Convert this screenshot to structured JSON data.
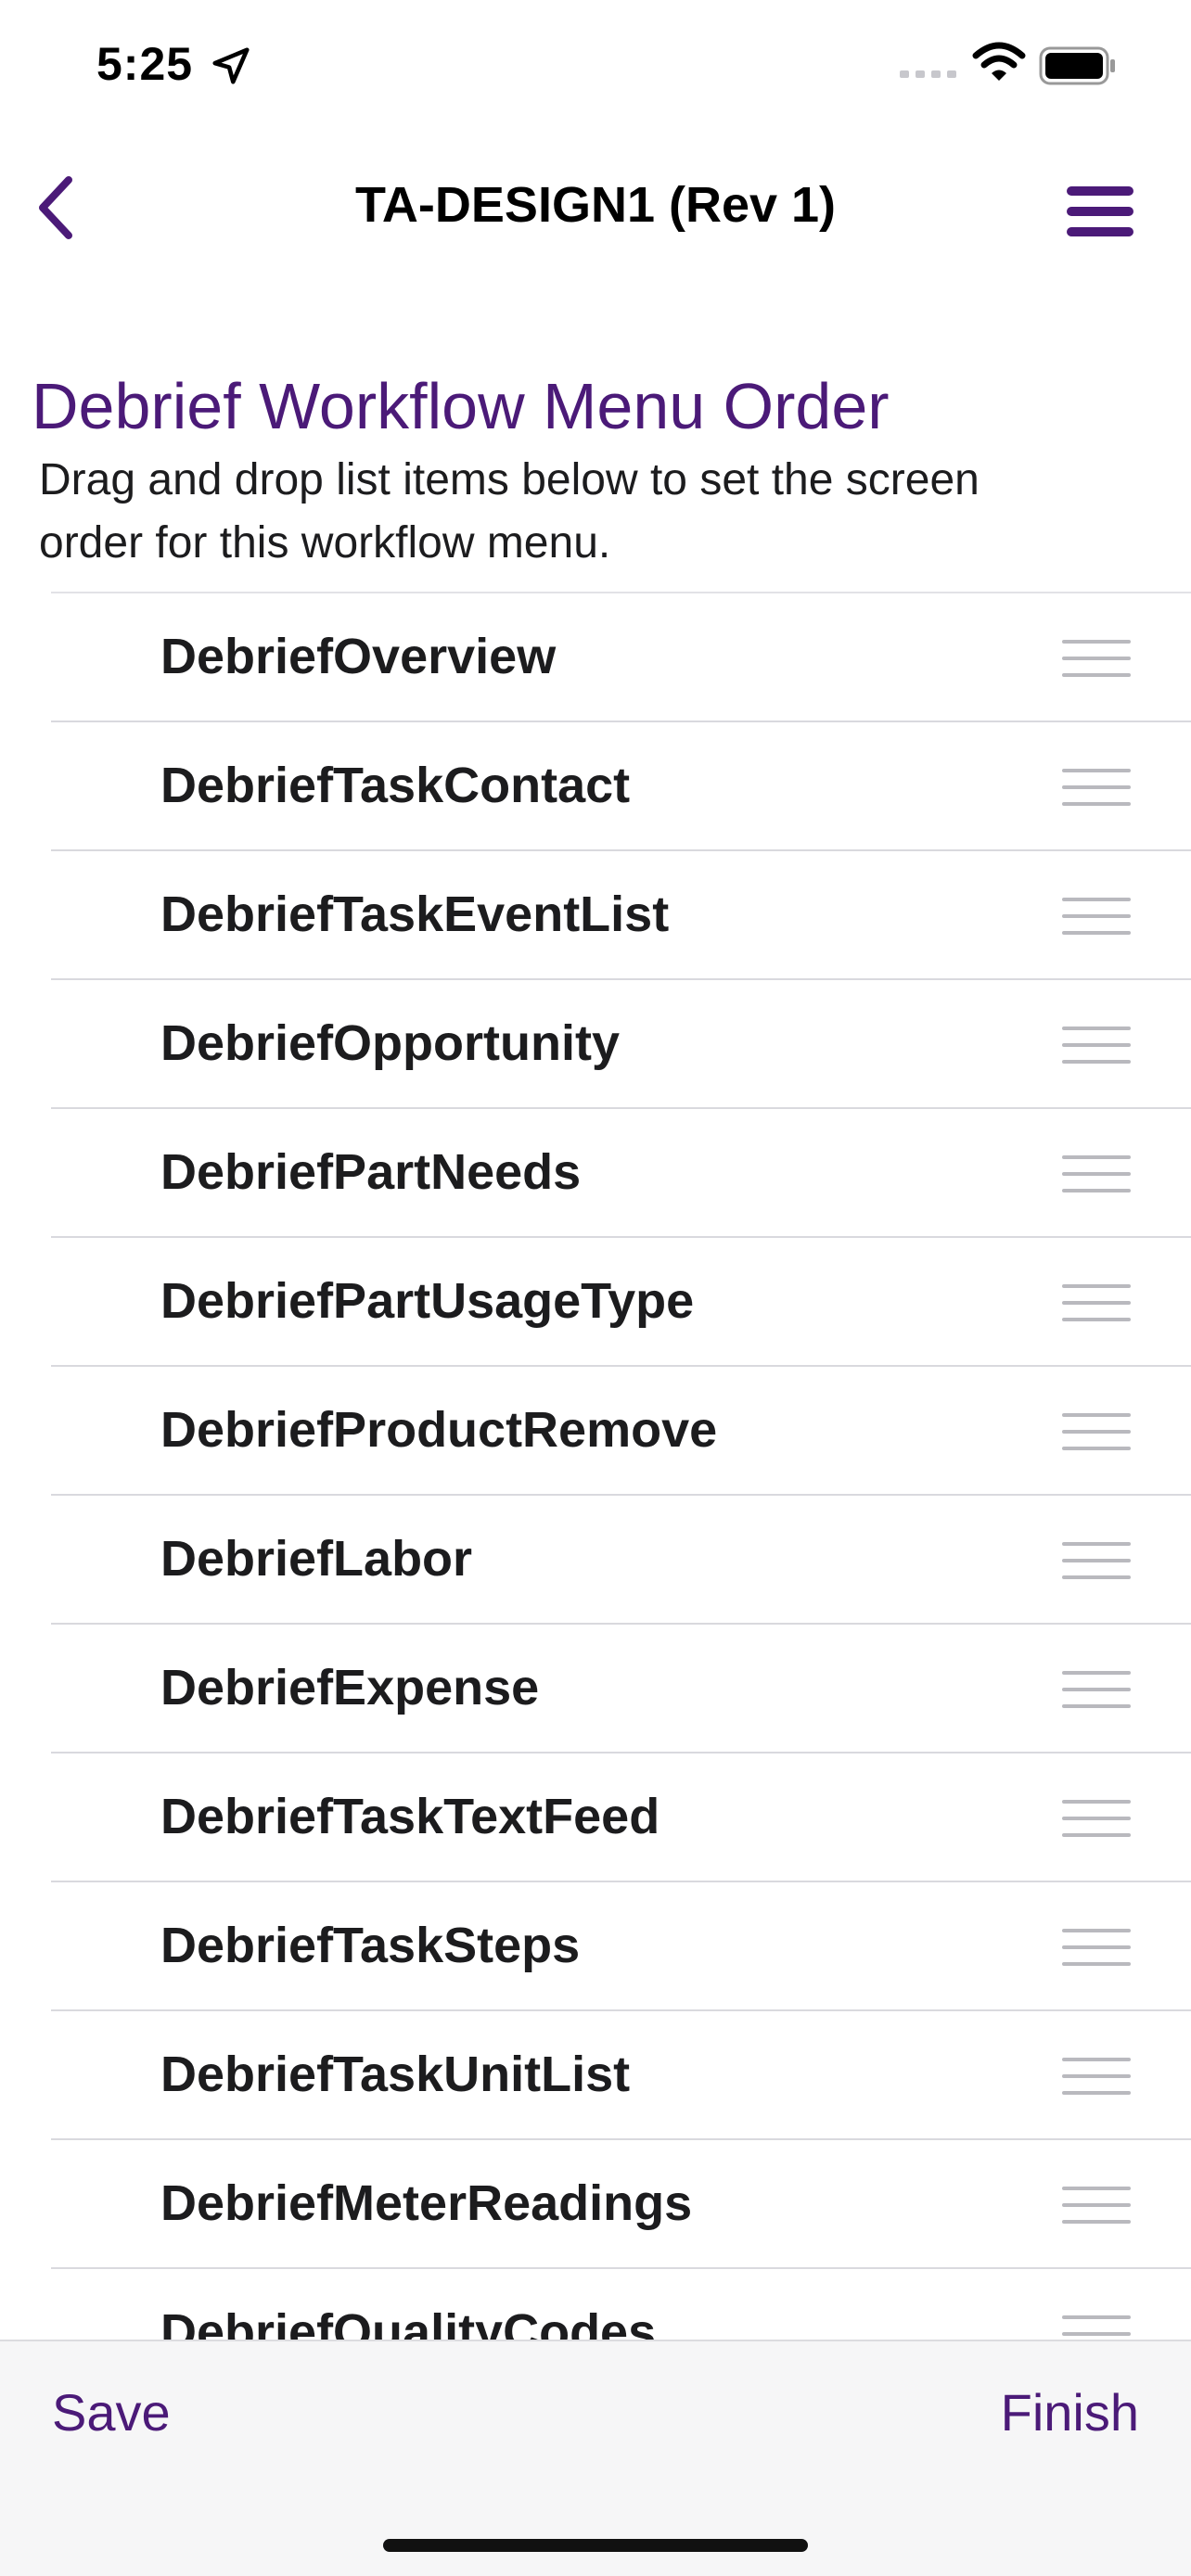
{
  "status_bar": {
    "time": "5:25",
    "icons": [
      "location-arrow-icon",
      "cellular-signal-icon",
      "wifi-icon",
      "battery-icon"
    ]
  },
  "nav": {
    "title": "TA-DESIGN1 (Rev 1)",
    "back_icon": "chevron-left-icon",
    "menu_icon": "hamburger-menu-icon"
  },
  "header": {
    "title": "Debrief Workflow Menu Order",
    "description": "Drag and drop list items below to set the screen order for this workflow menu."
  },
  "list": {
    "items": [
      "DebriefOverview",
      "DebriefTaskContact",
      "DebriefTaskEventList",
      "DebriefOpportunity",
      "DebriefPartNeeds",
      "DebriefPartUsageType",
      "DebriefProductRemove",
      "DebriefLabor",
      "DebriefExpense",
      "DebriefTaskTextFeed",
      "DebriefTaskSteps",
      "DebriefTaskUnitList",
      "DebriefMeterReadings",
      "DebriefQualityCodes"
    ]
  },
  "toolbar": {
    "save_label": "Save",
    "finish_label": "Finish"
  },
  "colors": {
    "accent": "#4b1a78",
    "separator": "#d9d9de",
    "toolbar_bg": "#f6f6f7"
  }
}
